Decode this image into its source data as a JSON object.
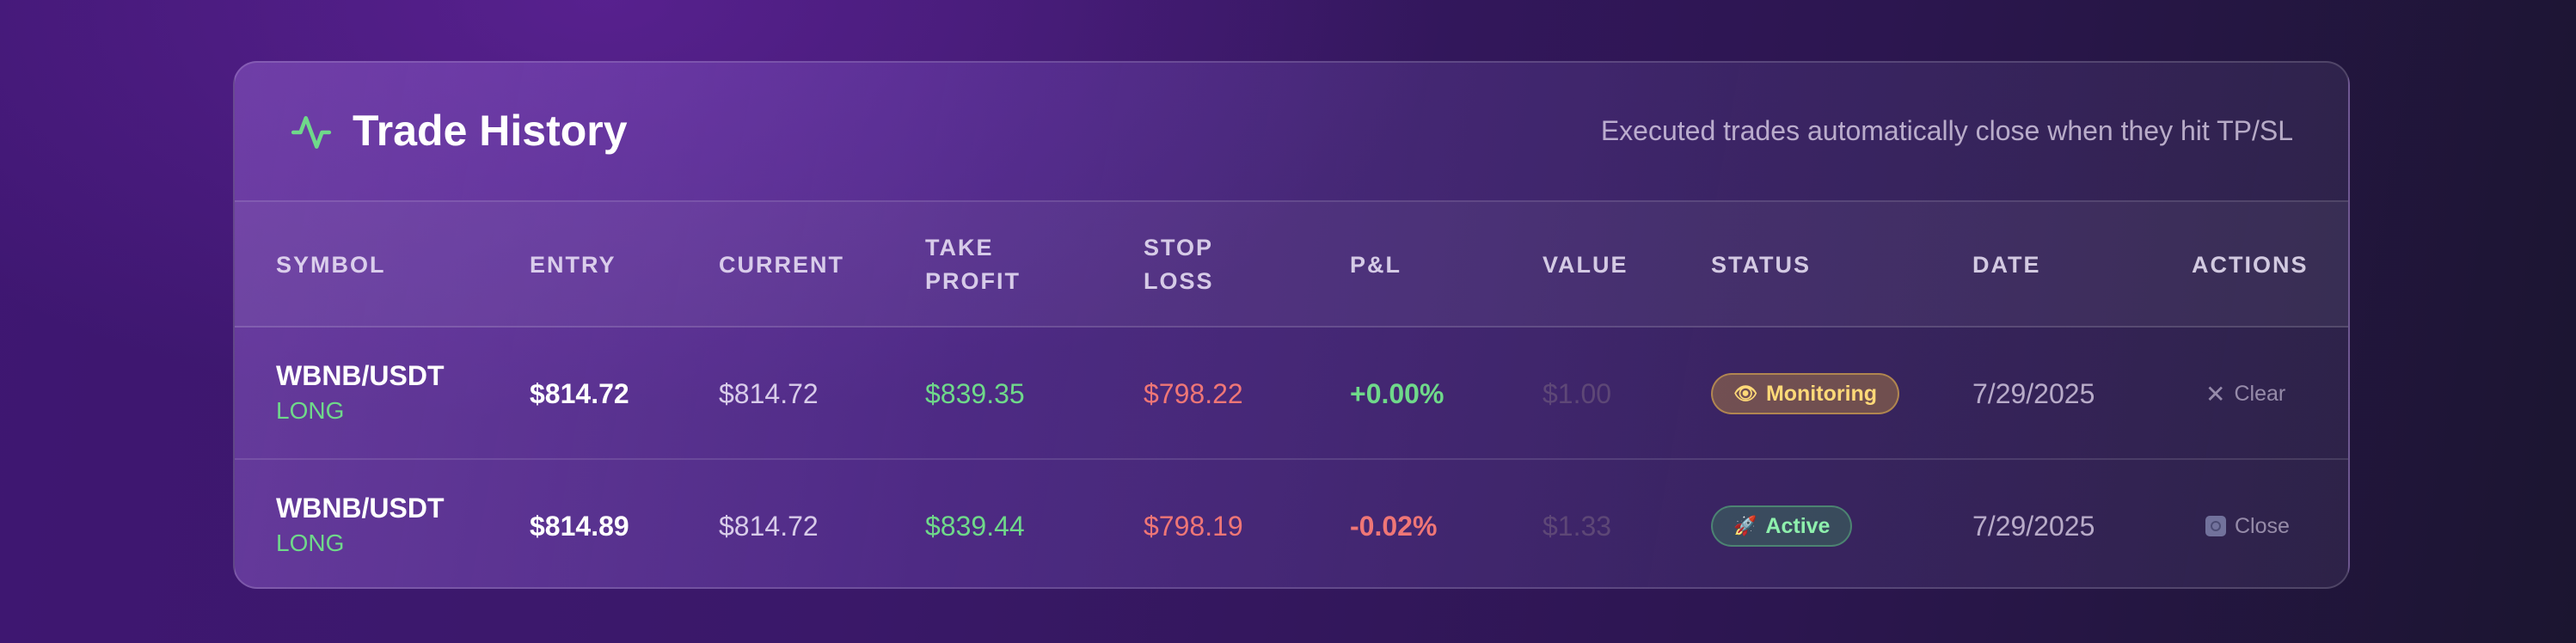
{
  "card": {
    "title": "Trade History",
    "subtitle": "Executed trades automatically close when they hit TP/SL",
    "icon": "activity-pulse-icon"
  },
  "table": {
    "headers": {
      "symbol": "SYMBOL",
      "entry": "ENTRY",
      "current": "CURRENT",
      "take_profit": "TAKE\nPROFIT",
      "stop_loss": "STOP\nLOSS",
      "pnl": "P&L",
      "value": "VALUE",
      "status": "STATUS",
      "date": "DATE",
      "actions": "ACTIONS"
    },
    "rows": [
      {
        "symbol": "WBNB/USDT",
        "side": "LONG",
        "entry": "$814.72",
        "current": "$814.72",
        "take_profit": "$839.35",
        "stop_loss": "$798.22",
        "pnl": "+0.00%",
        "value": "$1.00",
        "status": "Monitoring",
        "status_icon": "eye-icon",
        "date": "7/29/2025",
        "action": "Clear",
        "action_icon": "x-icon"
      },
      {
        "symbol": "WBNB/USDT",
        "side": "LONG",
        "entry": "$814.89",
        "current": "$814.72",
        "take_profit": "$839.44",
        "stop_loss": "$798.19",
        "pnl": "-0.02%",
        "value": "$1.33",
        "status": "Active",
        "status_icon": "rocket-icon",
        "date": "7/29/2025",
        "action": "Close",
        "action_icon": "close-square-icon"
      }
    ]
  },
  "colors": {
    "profit": "#6fd98a",
    "loss": "#ef7676",
    "monitoring": "#ffd978",
    "active": "#8ef0ad"
  }
}
